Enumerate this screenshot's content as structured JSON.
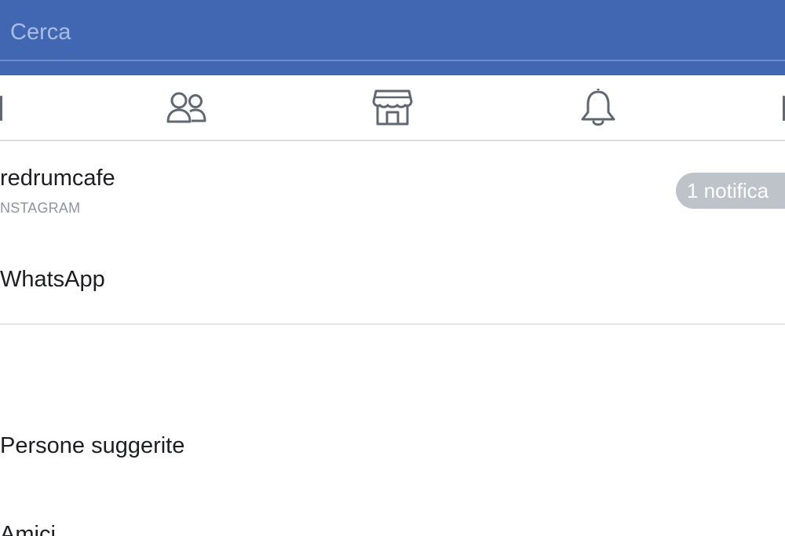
{
  "search": {
    "placeholder": "Cerca",
    "value": ""
  },
  "nav": {
    "items": [
      {
        "name": "friends",
        "icon": "friends-icon"
      },
      {
        "name": "marketplace",
        "icon": "marketplace-store-icon"
      },
      {
        "name": "notifications",
        "icon": "bell-icon"
      }
    ]
  },
  "accounts": [
    {
      "title": "redrumcafe",
      "subtitle": "NSTAGRAM",
      "badge": "1 notifica"
    },
    {
      "title": "WhatsApp"
    }
  ],
  "sections": {
    "suggested_people": "Persone suggerite",
    "friends": "Amici"
  },
  "colors": {
    "header_blue": "#4267b2",
    "badge_gray": "#bec2c9",
    "icon_gray": "#606770"
  }
}
